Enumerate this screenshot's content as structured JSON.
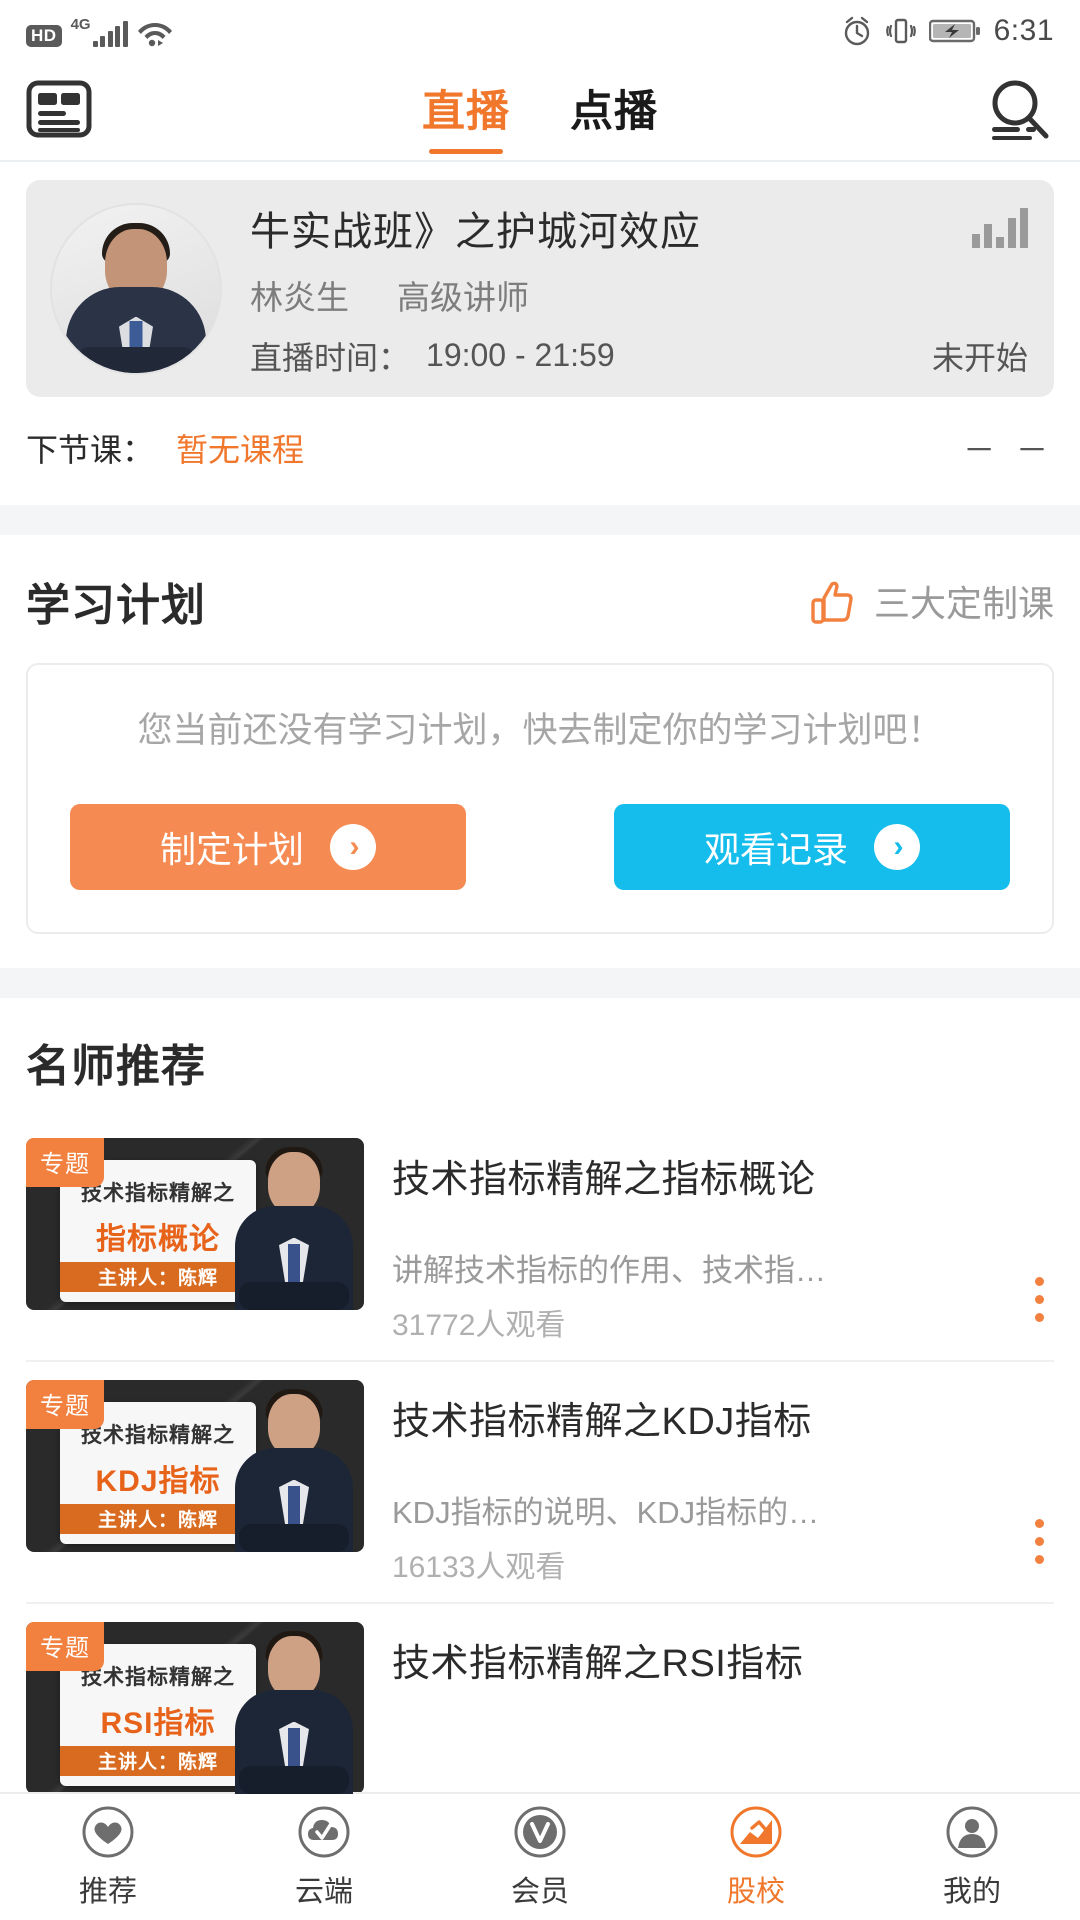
{
  "status_bar": {
    "hd_badge": "HD",
    "network": "4G",
    "icons": [
      "hd-icon",
      "signal-bars-icon",
      "wifi-icon",
      "alarm-icon",
      "vibrate-icon",
      "battery-charging-icon"
    ],
    "time": "6:31"
  },
  "top_nav": {
    "left_icon": "news-list-icon",
    "right_icon": "search-icon",
    "tabs": [
      {
        "label": "直播",
        "active": true
      },
      {
        "label": "点播",
        "active": false
      }
    ]
  },
  "live_card": {
    "avatar": "teacher-avatar",
    "title": "牛实战班》之护城河效应",
    "level_icon": "signal-level-icon",
    "teacher_name": "林炎生",
    "teacher_title": "高级讲师",
    "time_label": "直播时间：",
    "time_value": "19:00 - 21:59",
    "status": "未开始"
  },
  "next_lesson": {
    "label": "下节课：",
    "value": "暂无课程",
    "right": "－ －"
  },
  "study_plan": {
    "title": "学习计划",
    "link_icon": "thumbs-up-icon",
    "link_text": "三大定制课",
    "empty_text": "您当前还没有学习计划，快去制定你的学习计划吧！",
    "buttons": [
      {
        "label": "制定计划",
        "color": "#f58b52",
        "arrow": "›"
      },
      {
        "label": "观看记录",
        "color": "#14bdec",
        "arrow": "›"
      }
    ]
  },
  "recommend": {
    "title": "名师推荐",
    "items": [
      {
        "badge": "专题",
        "thumb_line1": "技术指标精解之",
        "thumb_line2": "指标概论",
        "thumb_presenter": "主讲人：陈辉",
        "title": "技术指标精解之指标概论",
        "desc": "讲解技术指标的作用、技术指…",
        "count": "31772人观看",
        "menu_icon": "kebab-menu-icon"
      },
      {
        "badge": "专题",
        "thumb_line1": "技术指标精解之",
        "thumb_line2": "KDJ指标",
        "thumb_presenter": "主讲人：陈辉",
        "title": "技术指标精解之KDJ指标",
        "desc": "KDJ指标的说明、KDJ指标的…",
        "count": "16133人观看",
        "menu_icon": "kebab-menu-icon"
      },
      {
        "badge": "专题",
        "thumb_line1": "技术指标精解之",
        "thumb_line2": "RSI指标",
        "thumb_presenter": "主讲人：陈辉",
        "title": "技术指标精解之RSI指标",
        "desc": "",
        "count": "",
        "menu_icon": "kebab-menu-icon"
      }
    ]
  },
  "bottom_nav": {
    "items": [
      {
        "label": "推荐",
        "icon": "heart-icon",
        "active": false
      },
      {
        "label": "云端",
        "icon": "cloud-check-icon",
        "active": false
      },
      {
        "label": "会员",
        "icon": "vip-icon",
        "active": false
      },
      {
        "label": "股校",
        "icon": "stock-school-icon",
        "active": true
      },
      {
        "label": "我的",
        "icon": "user-icon",
        "active": false
      }
    ]
  },
  "colors": {
    "accent_orange": "#f0772b",
    "button_orange": "#f58b52",
    "button_blue": "#14bdec",
    "card_grey": "#ebebeb",
    "page_grey": "#f4f5f6"
  }
}
